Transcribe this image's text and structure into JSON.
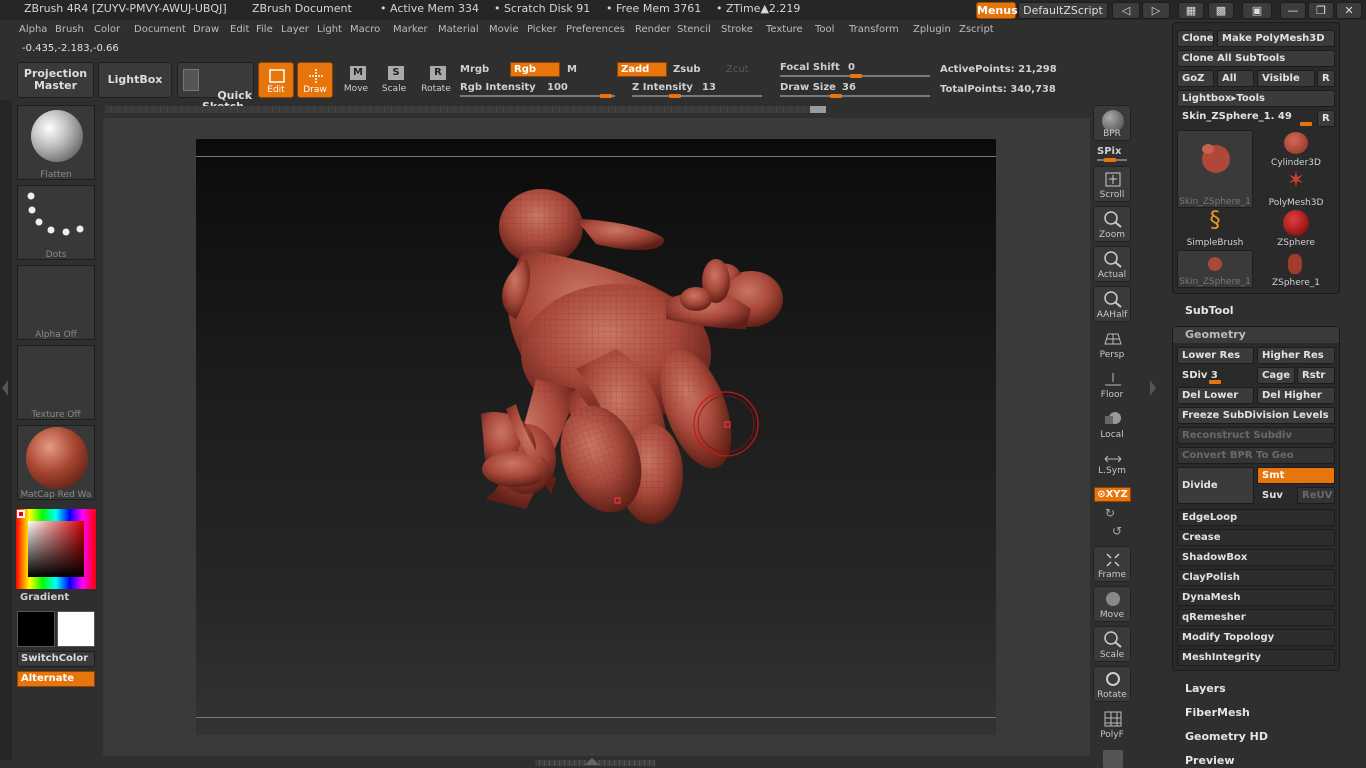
{
  "titlebar": {
    "app": "ZBrush 4R4 [ZUYV-PMVY-AWUJ-UBQJ]",
    "document": "ZBrush Document",
    "active_mem": "• Active Mem 334",
    "scratch_disk": "• Scratch Disk 91",
    "free_mem": "• Free Mem 3761",
    "ztime": "• ZTime▲2.219",
    "menus_btn": "Menus",
    "script_btn": "DefaultZScript"
  },
  "menubar": [
    "Alpha",
    "Brush",
    "Color",
    "Document",
    "Draw",
    "Edit",
    "File",
    "Layer",
    "Light",
    "Macro",
    "Marker",
    "Material",
    "Movie",
    "Picker",
    "Preferences",
    "Render",
    "Stencil",
    "Stroke",
    "Texture",
    "Tool",
    "Transform",
    "Zplugin",
    "Zscript"
  ],
  "coords": "-0.435,-2.183,-0.66",
  "shelf": {
    "projection_master": "Projection\nMaster",
    "lightbox": "LightBox",
    "quick_sketch": "Quick\nSketch",
    "edit": "Edit",
    "draw": "Draw",
    "move": "Move",
    "scale": "Scale",
    "rotate": "Rotate",
    "mrgb": "Mrgb",
    "rgb": "Rgb",
    "m": "M",
    "zadd": "Zadd",
    "zsub": "Zsub",
    "zcut": "Zcut",
    "rgb_intensity_label": "Rgb Intensity",
    "rgb_intensity": "100",
    "z_intensity_label": "Z Intensity",
    "z_intensity": "13",
    "focal_shift_label": "Focal Shift",
    "focal_shift": "0",
    "draw_size_label": "Draw Size",
    "draw_size": "36",
    "active_points": "ActivePoints: 21,298",
    "total_points": "TotalPoints: 340,738"
  },
  "left_tray": {
    "brush": "Flatten",
    "stroke": "Dots",
    "alpha": "Alpha  Off",
    "texture": "Texture  Off",
    "material": "MatCap  Red  Wa",
    "gradient": "Gradient",
    "switchcolor": "SwitchColor",
    "alternate": "Alternate"
  },
  "right_shelf": {
    "bpr": "BPR",
    "spix": "SPix",
    "scroll": "Scroll",
    "zoom": "Zoom",
    "actual": "Actual",
    "aahalf": "AAHalf",
    "persp": "Persp",
    "floor": "Floor",
    "local": "Local",
    "lsym": "L.Sym",
    "xyz": "⊙XYZ",
    "frame": "Frame",
    "move": "Move",
    "scale": "Scale",
    "rotate": "Rotate",
    "polyf": "PolyF"
  },
  "tool_palette": {
    "clone": "Clone",
    "make_polymesh": "Make PolyMesh3D",
    "clone_all": "Clone  All  SubTools",
    "goz": "GoZ",
    "all": "All",
    "visible": "Visible",
    "r": "R",
    "lightbox_tools": "Lightbox▸Tools",
    "current_tool": "Skin_ZSphere_1. 49",
    "tools": [
      {
        "name": "Skin_ZSphere_1"
      },
      {
        "name": "Cylinder3D"
      },
      {
        "name": "PolyMesh3D"
      },
      {
        "name": "SimpleBrush"
      },
      {
        "name": "ZSphere"
      },
      {
        "name": "Skin_ZSphere_1"
      },
      {
        "name": "ZSphere_1"
      }
    ]
  },
  "subtool": "SubTool",
  "geometry": {
    "title": "Geometry",
    "lower_res": "Lower  Res",
    "higher_res": "Higher  Res",
    "sdiv": "SDiv 3",
    "cage": "Cage",
    "rstr": "Rstr",
    "del_lower": "Del  Lower",
    "del_higher": "Del  Higher",
    "freeze": "Freeze  SubDivision  Levels",
    "reconstruct": "Reconstruct  Subdiv",
    "convert_bpr": "Convert  BPR  To  Geo",
    "divide": "Divide",
    "smt": "Smt",
    "suv": "Suv",
    "reuv": "ReUV",
    "edgeloop": "EdgeLoop",
    "crease": "Crease",
    "shadowbox": "ShadowBox",
    "claypolish": "ClayPolish",
    "dynamesh": "DynaMesh",
    "qremesher": "qRemesher",
    "modify_topology": "Modify  Topology",
    "meshintegrity": "MeshIntegrity"
  },
  "sections": {
    "layers": "Layers",
    "fibermesh": "FiberMesh",
    "geometry_hd": "Geometry  HD",
    "preview": "Preview"
  },
  "colors": {
    "accent": "#e8740c",
    "mesh": "#b0483a",
    "background": "#2f2f2f"
  }
}
